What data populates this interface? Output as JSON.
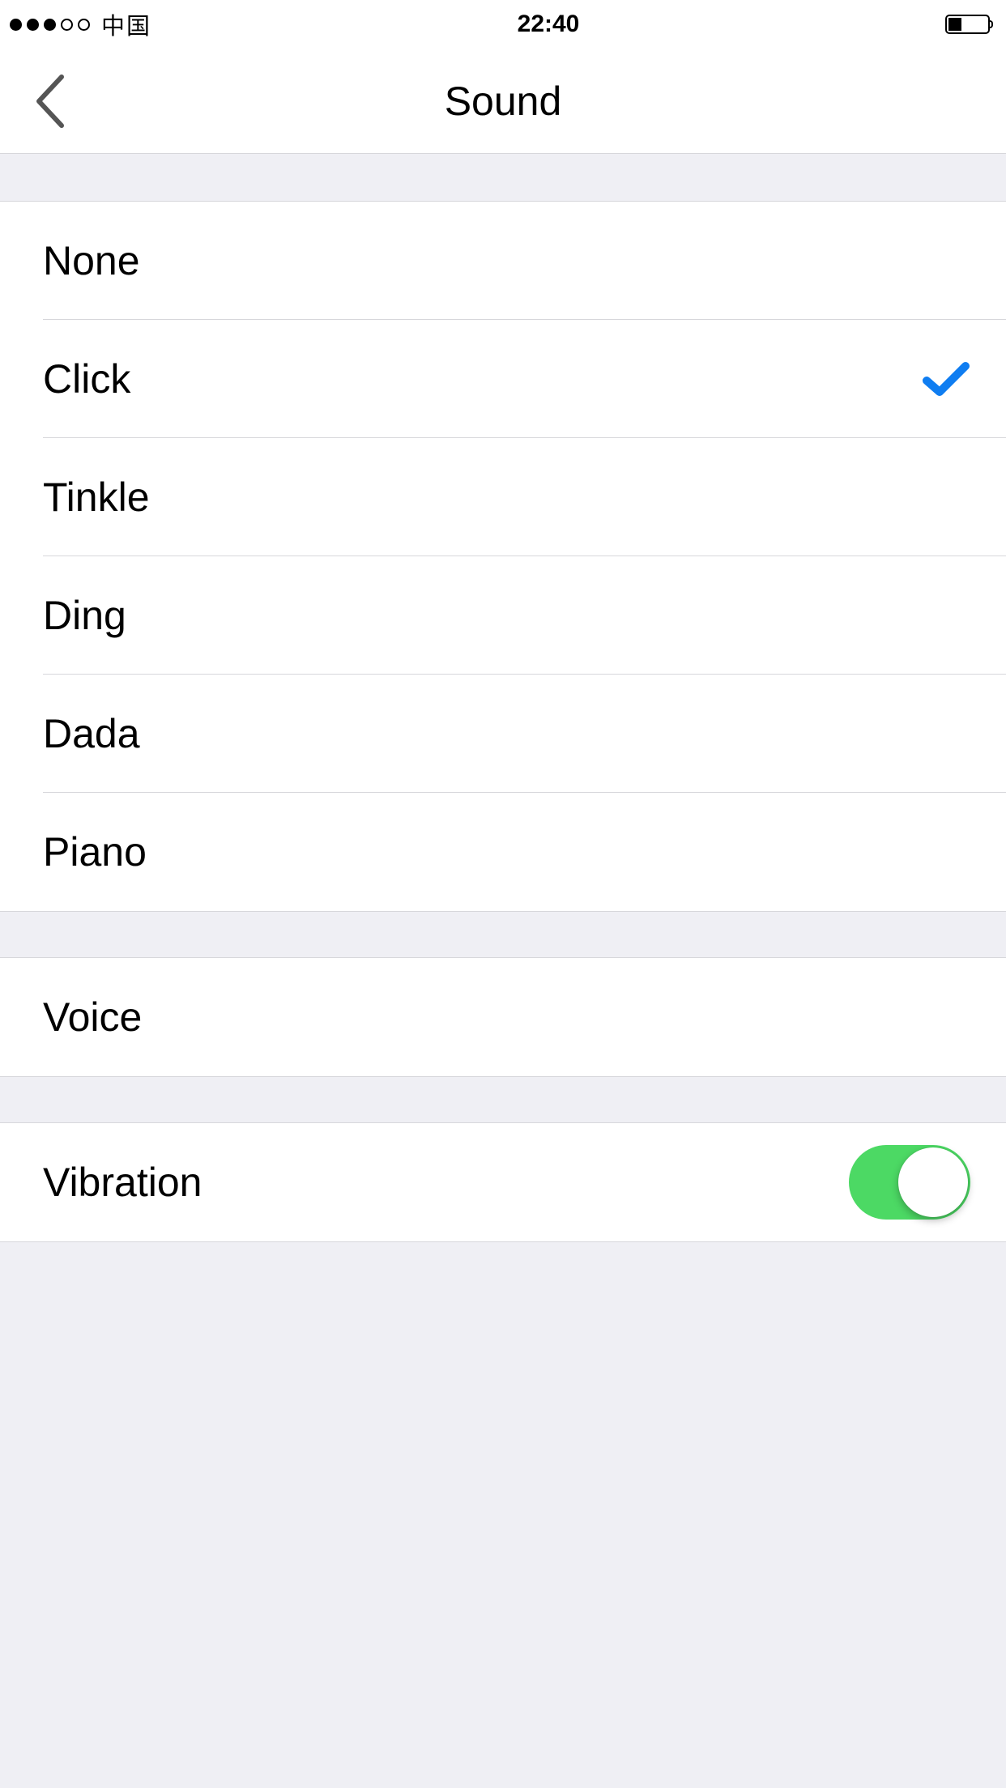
{
  "status_bar": {
    "signal_strength": 3,
    "signal_total": 5,
    "carrier": "中国",
    "time": "22:40",
    "battery_percent": 30
  },
  "nav": {
    "title": "Sound",
    "back_icon": "chevron-left-icon"
  },
  "sound_options": {
    "selected_index": 1,
    "items": [
      {
        "label": "None"
      },
      {
        "label": "Click"
      },
      {
        "label": "Tinkle"
      },
      {
        "label": "Ding"
      },
      {
        "label": "Dada"
      },
      {
        "label": "Piano"
      }
    ]
  },
  "voice_section": {
    "label": "Voice"
  },
  "vibration_section": {
    "label": "Vibration",
    "enabled": true
  },
  "colors": {
    "accent_check": "#0f7df1",
    "toggle_on": "#4cd964",
    "separator": "#d7d7db",
    "bg": "#efeff4"
  }
}
